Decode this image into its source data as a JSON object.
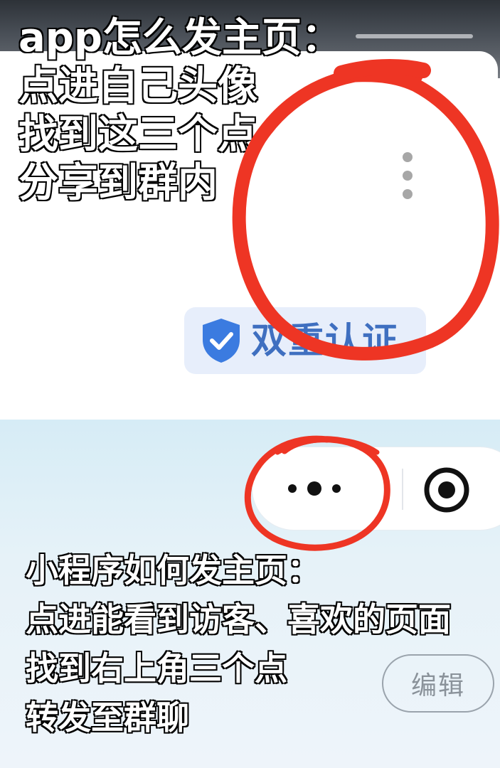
{
  "top": {
    "caption_lines": [
      "app怎么发主页：",
      "点进自己头像",
      "找到这三个点",
      "分享到群内"
    ],
    "badge_label": "双重认证",
    "kebab_icon": "vertical-ellipsis-icon",
    "shield_icon": "shield-check-icon",
    "annotation_color": "#ee3524"
  },
  "bottom": {
    "caption_lines": [
      "小程序如何发主页：",
      "点进能看到访客、喜欢的页面",
      "找到右上角三个点",
      "转发至群聊"
    ],
    "edit_label": "编辑",
    "more_icon": "horizontal-ellipsis-icon",
    "close_icon": "target-circle-icon",
    "annotation_color": "#ee3524"
  }
}
